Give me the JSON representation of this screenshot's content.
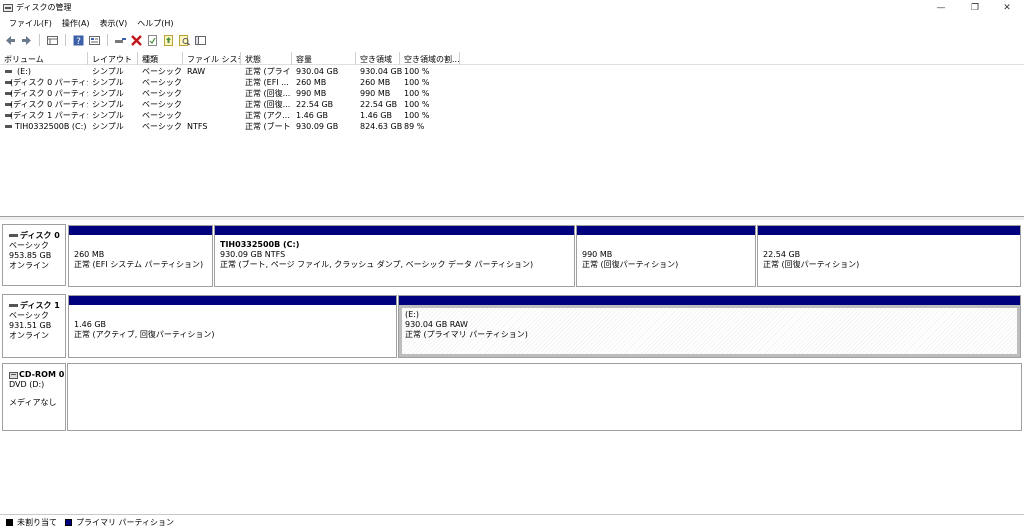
{
  "window": {
    "title": "ディスクの管理",
    "minimize": "—",
    "restore": "❐",
    "close": "✕"
  },
  "menu": [
    "ファイル(F)",
    "操作(A)",
    "表示(V)",
    "ヘルプ(H)"
  ],
  "toolbar": [
    "back-icon",
    "forward-icon",
    "list-view-icon",
    "help-icon",
    "properties-icon",
    "connect-icon",
    "delete-icon",
    "check-icon",
    "refresh-icon",
    "search-icon",
    "console-icon"
  ],
  "columns": [
    "ボリューム",
    "レイアウト",
    "種類",
    "ファイル システム",
    "状態",
    "容量",
    "空き領域",
    "空き領域の割..."
  ],
  "volumes": [
    [
      "(E:)",
      "シンプル",
      "ベーシック",
      "RAW",
      "正常 (プライ...",
      "930.04 GB",
      "930.04 GB",
      "100 %"
    ],
    [
      "(ディスク 0 パーティショ...",
      "シンプル",
      "ベーシック",
      "",
      "正常 (EFI ...",
      "260 MB",
      "260 MB",
      "100 %"
    ],
    [
      "(ディスク 0 パーティショ...",
      "シンプル",
      "ベーシック",
      "",
      "正常 (回復...",
      "990 MB",
      "990 MB",
      "100 %"
    ],
    [
      "(ディスク 0 パーティショ...",
      "シンプル",
      "ベーシック",
      "",
      "正常 (回復...",
      "22.54 GB",
      "22.54 GB",
      "100 %"
    ],
    [
      "(ディスク 1 パーティショ...",
      "シンプル",
      "ベーシック",
      "",
      "正常 (アク...",
      "1.46 GB",
      "1.46 GB",
      "100 %"
    ],
    [
      "TIH0332500B (C:)",
      "シンプル",
      "ベーシック",
      "NTFS",
      "正常 (ブート...",
      "930.09 GB",
      "824.63 GB",
      "89 %"
    ]
  ],
  "disks": {
    "disk0": {
      "name": "ディスク 0",
      "type": "ベーシック",
      "size": "953.85 GB",
      "status": "オンライン",
      "partitions": [
        {
          "title": "",
          "size": "260 MB",
          "desc": "正常 (EFI システム パーティション)"
        },
        {
          "title": "TIH0332500B  (C:)",
          "size": "930.09 GB NTFS",
          "desc": "正常 (ブート, ページ ファイル, クラッシュ ダンプ, ベーシック データ パーティション)"
        },
        {
          "title": "",
          "size": "990 MB",
          "desc": "正常 (回復パーティション)"
        },
        {
          "title": "",
          "size": "22.54 GB",
          "desc": "正常 (回復パーティション)"
        }
      ]
    },
    "disk1": {
      "name": "ディスク 1",
      "type": "ベーシック",
      "size": "931.51 GB",
      "status": "オンライン",
      "partitions": [
        {
          "title": "",
          "size": "1.46 GB",
          "desc": "正常 (アクティブ, 回復パーティション)"
        },
        {
          "title": "(E:)",
          "size": "930.04 GB RAW",
          "desc": "正常 (プライマリ パーティション)"
        }
      ]
    },
    "cdrom": {
      "name": "CD-ROM 0",
      "drive": "DVD (D:)",
      "status": "メディアなし"
    }
  },
  "legend": {
    "unallocated": "未割り当て",
    "primary": "プライマリ パーティション"
  },
  "colors": {
    "primary_partition": "#00007f",
    "unallocated": "#000000"
  }
}
